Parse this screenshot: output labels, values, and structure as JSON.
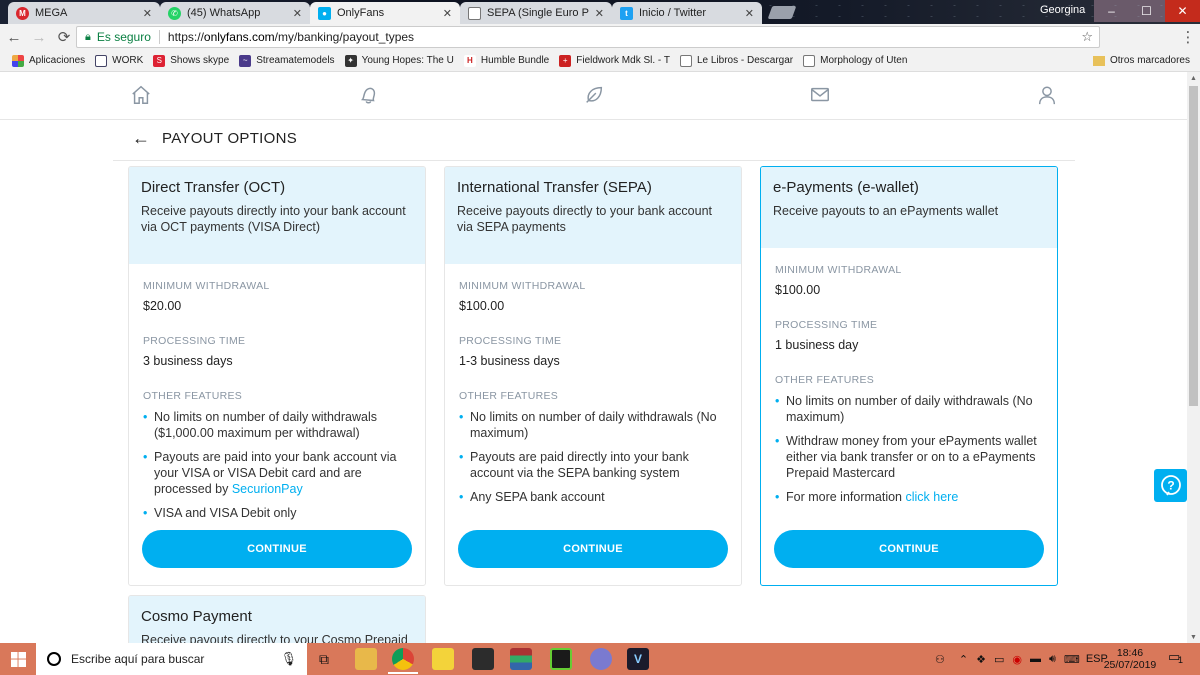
{
  "browser": {
    "tabs": [
      {
        "title": "MEGA",
        "icon": "mega-icon",
        "icon_color": "#d9272e"
      },
      {
        "title": "(45) WhatsApp",
        "icon": "whatsapp-icon",
        "icon_color": "#25d366"
      },
      {
        "title": "OnlyFans",
        "icon": "onlyfans-icon",
        "icon_color": "#00aff0"
      },
      {
        "title": "SEPA (Single Euro Payme",
        "icon": "document-icon",
        "icon_color": "#ffffff"
      },
      {
        "title": "Inicio / Twitter",
        "icon": "twitter-icon",
        "icon_color": "#1da1f2"
      }
    ],
    "window_user": "Georgina",
    "security_label": "Es seguro",
    "url_prefix": "https://",
    "url_domain": "onlyfans.com",
    "url_path": "/my/banking/payout_types",
    "bookmarks": [
      {
        "label": "Aplicaciones",
        "icon": "apps-grid-icon"
      },
      {
        "label": "WORK",
        "icon": "work-icon"
      },
      {
        "label": "Shows skype",
        "icon": "skype-icon"
      },
      {
        "label": "Streamatemodels",
        "icon": "streamate-icon"
      },
      {
        "label": "Young Hopes: The U",
        "icon": "bookmark-icon"
      },
      {
        "label": "Humble Bundle",
        "icon": "humble-icon"
      },
      {
        "label": "Fieldwork Mdk Sl. - T",
        "icon": "fieldwork-icon"
      },
      {
        "label": "Le Libros - Descargar",
        "icon": "page-icon"
      },
      {
        "label": "Morphology of Uten",
        "icon": "page-icon"
      }
    ],
    "other_bookmarks": "Otros marcadores"
  },
  "page": {
    "header": {
      "title": "PAYOUT OPTIONS"
    },
    "cards": [
      {
        "name": "Direct Transfer (OCT)",
        "description": "Receive payouts directly into your bank account via OCT payments (VISA Direct)",
        "min_label": "MINIMUM WITHDRAWAL",
        "min_value": "$20.00",
        "time_label": "PROCESSING TIME",
        "time_value": "3 business days",
        "features_label": "OTHER FEATURES",
        "features": [
          "No limits on number of daily withdrawals ($1,000.00 maximum per withdrawal)",
          "Payouts are paid into your bank account via your VISA or VISA Debit card and are processed by ",
          "VISA and VISA Debit only"
        ],
        "feature_link": "SecurionPay",
        "button": "CONTINUE"
      },
      {
        "name": "International Transfer (SEPA)",
        "description": "Receive payouts directly to your bank account via SEPA payments",
        "min_label": "MINIMUM WITHDRAWAL",
        "min_value": "$100.00",
        "time_label": "PROCESSING TIME",
        "time_value": "1-3 business days",
        "features_label": "OTHER FEATURES",
        "features": [
          "No limits on number of daily withdrawals (No maximum)",
          "Payouts are paid directly into your bank account via the SEPA banking system",
          "Any SEPA bank account"
        ],
        "button": "CONTINUE"
      },
      {
        "name": "e-Payments (e-wallet)",
        "description": "Receive payouts to an ePayments wallet",
        "min_label": "MINIMUM WITHDRAWAL",
        "min_value": "$100.00",
        "time_label": "PROCESSING TIME",
        "time_value": "1 business day",
        "features_label": "OTHER FEATURES",
        "features": [
          "No limits on number of daily withdrawals (No maximum)",
          "Withdraw money from your ePayments wallet either via bank transfer or on to a ePayments Prepaid Mastercard",
          "For more information "
        ],
        "feature_link": "click here",
        "button": "CONTINUE"
      },
      {
        "name": "Cosmo Payment",
        "description": "Receive payouts directly to your Cosmo Prepaid"
      }
    ],
    "accent_color": "#00aff0"
  },
  "taskbar": {
    "search_placeholder": "Escribe aquí para buscar",
    "language": "ESP",
    "time": "18:46",
    "date": "25/07/2019",
    "notification_count": "1"
  }
}
